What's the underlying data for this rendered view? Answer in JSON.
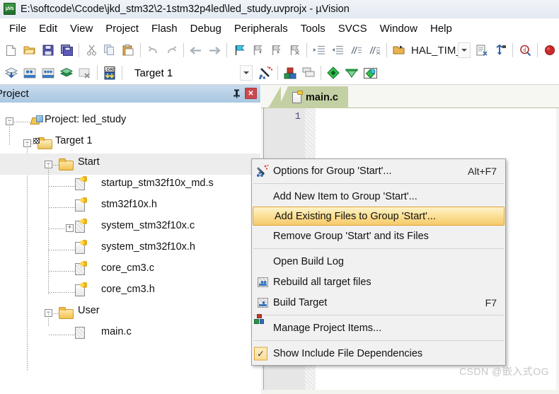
{
  "window": {
    "title": "E:\\softcode\\Ccode\\jkd_stm32\\2-1stm32p4led\\led_study.uvprojx - µVision",
    "app_icon": "uvision-icon"
  },
  "menubar": {
    "items": [
      {
        "label": "File"
      },
      {
        "label": "Edit"
      },
      {
        "label": "View"
      },
      {
        "label": "Project"
      },
      {
        "label": "Flash"
      },
      {
        "label": "Debug"
      },
      {
        "label": "Peripherals"
      },
      {
        "label": "Tools"
      },
      {
        "label": "SVCS"
      },
      {
        "label": "Window"
      },
      {
        "label": "Help"
      }
    ]
  },
  "toolbar": {
    "row1": [
      {
        "name": "new-file-icon"
      },
      {
        "name": "open-file-icon"
      },
      {
        "name": "save-icon"
      },
      {
        "name": "save-all-icon"
      },
      {
        "name": "cut-icon"
      },
      {
        "name": "copy-icon"
      },
      {
        "name": "paste-icon"
      },
      {
        "name": "undo-icon"
      },
      {
        "name": "redo-icon"
      },
      {
        "name": "navigate-back-icon"
      },
      {
        "name": "navigate-forward-icon"
      },
      {
        "name": "bookmark-toggle-icon"
      },
      {
        "name": "bookmark-prev-icon"
      },
      {
        "name": "bookmark-next-icon"
      },
      {
        "name": "bookmark-clear-icon"
      },
      {
        "name": "indent-increase-icon"
      },
      {
        "name": "indent-decrease-icon"
      },
      {
        "name": "comment-icon"
      },
      {
        "name": "uncomment-icon"
      }
    ],
    "row2": [
      {
        "name": "build-icon"
      },
      {
        "name": "rebuild-icon"
      },
      {
        "name": "batch-build-icon"
      },
      {
        "name": "stop-build-icon"
      },
      {
        "name": "translate-icon"
      },
      {
        "name": "download-icon"
      }
    ],
    "function_combo_value": "HAL_TIM_PeriodE",
    "target_combo_value": "Target 1",
    "right_icons": [
      {
        "name": "insert-bookmark-icon"
      },
      {
        "name": "find-in-files-icon"
      },
      {
        "name": "start-debug-icon"
      }
    ],
    "row2_right_icons": [
      {
        "name": "target-options-icon"
      },
      {
        "name": "manage-components-icon"
      },
      {
        "name": "manage-runtime-icon"
      },
      {
        "name": "multi-project-icon"
      },
      {
        "name": "pack-installer-icon"
      },
      {
        "name": "configuration-wizard-icon"
      }
    ]
  },
  "project_panel": {
    "title": "Project",
    "pin_icon": "pin-icon",
    "close_icon": "close-icon",
    "tree": [
      {
        "label": "Project: led_study",
        "depth": 0,
        "icon": "project-icon",
        "expander": "-",
        "selected": false
      },
      {
        "label": "Target 1",
        "depth": 1,
        "icon": "target-folder-icon",
        "expander": "-",
        "selected": false
      },
      {
        "label": "Start",
        "depth": 2,
        "icon": "folder-icon",
        "expander": "-",
        "selected": true
      },
      {
        "label": "startup_stm32f10x_md.s",
        "depth": 3,
        "icon": "source-file-icon",
        "expander": "",
        "selected": false
      },
      {
        "label": "stm32f10x.h",
        "depth": 3,
        "icon": "header-file-icon",
        "expander": "",
        "selected": false
      },
      {
        "label": "system_stm32f10x.c",
        "depth": 3,
        "icon": "source-file-icon",
        "expander": "+",
        "selected": false
      },
      {
        "label": "system_stm32f10x.h",
        "depth": 3,
        "icon": "header-file-icon",
        "expander": "",
        "selected": false
      },
      {
        "label": "core_cm3.c",
        "depth": 3,
        "icon": "source-file-icon",
        "expander": "",
        "selected": false
      },
      {
        "label": "core_cm3.h",
        "depth": 3,
        "icon": "header-file-icon",
        "expander": "",
        "selected": false
      },
      {
        "label": "User",
        "depth": 2,
        "icon": "folder-icon",
        "expander": "-",
        "selected": false
      },
      {
        "label": "main.c",
        "depth": 3,
        "icon": "plain-file-icon",
        "expander": "",
        "selected": false
      }
    ]
  },
  "editor": {
    "tab_label": "main.c",
    "tab_icon": "c-file-icon",
    "line_numbers": [
      "1"
    ],
    "watermark": "CSDN @嵌入式OG"
  },
  "context_menu": {
    "items": [
      {
        "type": "item",
        "label": "Options for Group 'Start'...",
        "accel": "Alt+F7",
        "icon": "magic-wand-icon",
        "highlighted": false
      },
      {
        "type": "sep"
      },
      {
        "type": "item",
        "label": "Add New  Item to Group 'Start'...",
        "accel": "",
        "icon": "",
        "highlighted": false
      },
      {
        "type": "item",
        "label": "Add Existing Files to Group 'Start'...",
        "accel": "",
        "icon": "",
        "highlighted": true
      },
      {
        "type": "item",
        "label": "Remove Group 'Start' and its Files",
        "accel": "",
        "icon": "",
        "highlighted": false
      },
      {
        "type": "sep"
      },
      {
        "type": "item",
        "label": "Open Build Log",
        "accel": "",
        "icon": "",
        "highlighted": false
      },
      {
        "type": "item",
        "label": "Rebuild all target files",
        "accel": "",
        "icon": "rebuild-icon",
        "highlighted": false
      },
      {
        "type": "item",
        "label": "Build Target",
        "accel": "F7",
        "icon": "build-icon",
        "highlighted": false
      },
      {
        "type": "sep"
      },
      {
        "type": "item",
        "label": "Manage Project Items...",
        "accel": "",
        "icon": "manage-project-icon",
        "highlighted": false
      },
      {
        "type": "sep"
      },
      {
        "type": "item",
        "label": "Show Include File Dependencies",
        "accel": "",
        "icon": "checkmark-icon",
        "highlighted": false
      }
    ]
  },
  "colors": {
    "highlight_border": "#e0a13a",
    "panel_header": "#b6cfe6",
    "tab_active": "#c3d0a3",
    "close_button": "#c9494c"
  }
}
